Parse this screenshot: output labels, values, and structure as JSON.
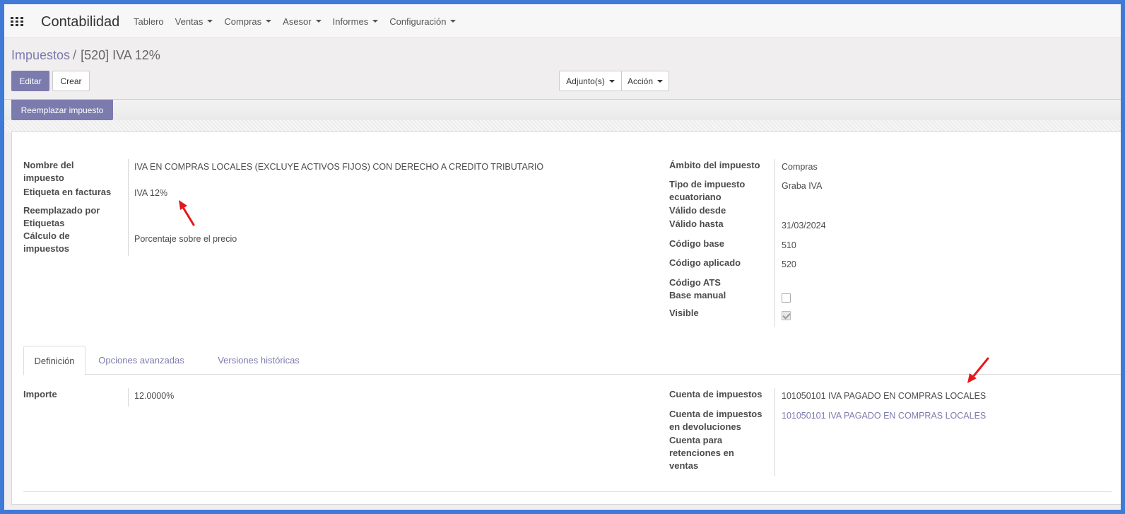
{
  "navbar": {
    "brand": "Contabilidad",
    "menu": [
      {
        "label": "Tablero",
        "dropdown": false
      },
      {
        "label": "Ventas",
        "dropdown": true
      },
      {
        "label": "Compras",
        "dropdown": true
      },
      {
        "label": "Asesor",
        "dropdown": true
      },
      {
        "label": "Informes",
        "dropdown": true
      },
      {
        "label": "Configuración",
        "dropdown": true
      }
    ]
  },
  "breadcrumb": {
    "parent": "Impuestos",
    "separator": "/",
    "current": "[520] IVA 12%"
  },
  "buttons": {
    "edit": "Editar",
    "create": "Crear",
    "attachments": "Adjunto(s)",
    "action": "Acción",
    "replace_tax": "Reemplazar impuesto"
  },
  "form": {
    "left": {
      "tax_name_label": "Nombre del impuesto",
      "tax_name_value": "IVA EN COMPRAS LOCALES (EXCLUYE ACTIVOS FIJOS) CON DERECHO A CREDITO TRIBUTARIO",
      "invoice_label_label": "Etiqueta en facturas",
      "invoice_label_value": "IVA 12%",
      "replaced_by_label": "Reemplazado por",
      "tags_label": "Etiquetas",
      "tax_computation_label": "Cálculo de impuestos",
      "tax_computation_value": "Porcentaje sobre el precio"
    },
    "right": {
      "tax_scope_label": "Ámbito del impuesto",
      "tax_scope_value": "Compras",
      "ec_tax_type_label": "Tipo de impuesto ecuatoriano",
      "ec_tax_type_value": "Graba IVA",
      "valid_from_label": "Válido desde",
      "valid_to_label": "Válido hasta",
      "valid_to_value": "31/03/2024",
      "base_code_label": "Código base",
      "base_code_value": "510",
      "applied_code_label": "Código aplicado",
      "applied_code_value": "520",
      "ats_code_label": "Código ATS",
      "manual_base_label": "Base manual",
      "manual_base_checked": false,
      "visible_label": "Visible",
      "visible_checked": true
    }
  },
  "tabs": [
    "Definición",
    "Opciones avanzadas",
    "Versiones históricas"
  ],
  "definition": {
    "amount_label": "Importe",
    "amount_value": "12.0000%",
    "tax_account_label": "Cuenta de impuestos",
    "tax_account_value": "101050101 IVA PAGADO EN COMPRAS LOCALES",
    "refund_account_label": "Cuenta de impuestos en devoluciones",
    "refund_account_value": "101050101 IVA PAGADO EN COMPRAS LOCALES",
    "sales_withholding_label": "Cuenta para retenciones en ventas"
  },
  "colors": {
    "accent": "#7c7bad",
    "frame": "#3f7ad6",
    "annotation_arrow": "#e8161b"
  }
}
